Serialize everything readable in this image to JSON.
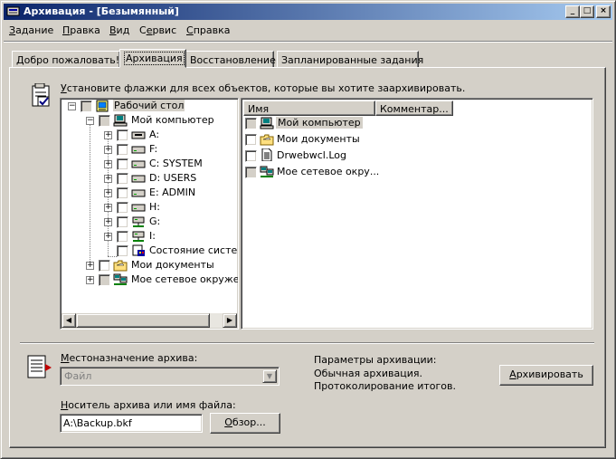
{
  "window": {
    "title": "Архивация - [Безымянный]",
    "controls": {
      "minimize": "_",
      "maximize": "□",
      "close": "×"
    }
  },
  "menu": [
    {
      "label": "Задание",
      "accel": "З",
      "rest": "адание"
    },
    {
      "label": "Правка",
      "accel": "П",
      "rest": "равка"
    },
    {
      "label": "Вид",
      "accel": "В",
      "rest": "ид"
    },
    {
      "label": "Сервис",
      "accel": "е",
      "pre": "С",
      "rest": "рвис"
    },
    {
      "label": "Справка",
      "accel": "С",
      "rest": "правка"
    }
  ],
  "tabs": [
    {
      "label": "Добро пожаловать!",
      "active": false
    },
    {
      "label": "Архивация",
      "active": true
    },
    {
      "label": "Восстановление",
      "active": false
    },
    {
      "label": "Запланированные задания",
      "active": false
    }
  ],
  "instruction": {
    "accel": "У",
    "rest": "становите флажки для всех объектов, которые вы хотите заархивировать."
  },
  "tree": [
    {
      "label": "Рабочий стол",
      "icon": "desktop-icon",
      "expander": "−",
      "check": "gray",
      "selected": true
    },
    {
      "label": "Мой компьютер",
      "icon": "computer-icon",
      "expander": "−",
      "check": "gray"
    },
    {
      "label": "A:",
      "icon": "floppy-drive-icon",
      "expander": "+",
      "check": "white"
    },
    {
      "label": "F:",
      "icon": "drive-icon",
      "expander": "+",
      "check": "white"
    },
    {
      "label": "C: SYSTEM",
      "icon": "drive-icon",
      "expander": "+",
      "check": "white"
    },
    {
      "label": "D: USERS",
      "icon": "drive-icon",
      "expander": "+",
      "check": "white"
    },
    {
      "label": "E: ADMIN",
      "icon": "drive-icon",
      "expander": "+",
      "check": "white"
    },
    {
      "label": "H:",
      "icon": "drive-icon",
      "expander": "+",
      "check": "white"
    },
    {
      "label": "G:",
      "icon": "network-drive-icon",
      "expander": "+",
      "check": "white"
    },
    {
      "label": "I:",
      "icon": "network-drive-icon",
      "expander": "+",
      "check": "white"
    },
    {
      "label": "Состояние систе",
      "icon": "system-state-icon",
      "expander": "",
      "check": "white"
    },
    {
      "label": "Мои документы",
      "icon": "documents-folder-icon",
      "expander": "+",
      "check": "white"
    },
    {
      "label": "Мое сетевое окруже",
      "icon": "network-places-icon",
      "expander": "+",
      "check": "gray"
    }
  ],
  "list": {
    "columns": [
      "Имя",
      "Комментар..."
    ],
    "rows": [
      {
        "label": "Мой компьютер",
        "icon": "computer-icon",
        "check": "gray",
        "selected": true
      },
      {
        "label": "Мои документы",
        "icon": "documents-folder-icon",
        "check": "white"
      },
      {
        "label": "Drwebwcl.Log",
        "icon": "text-file-icon",
        "check": "white"
      },
      {
        "label": "Мое сетевое окру...",
        "icon": "network-places-icon",
        "check": "gray"
      }
    ]
  },
  "destination": {
    "label_accel": "М",
    "label_rest": "естоназначение архива:",
    "value": "Файл"
  },
  "media": {
    "label_accel": "Н",
    "label_rest": "оситель архива или имя файла:",
    "value": "A:\\Backup.bkf",
    "browse_accel": "О",
    "browse_rest": "бзор..."
  },
  "params": {
    "title": "Параметры архивации:",
    "line1": "Обычная архивация.",
    "line2": "Протоколирование итогов."
  },
  "archive_button": {
    "accel": "А",
    "rest": "рхивировать"
  }
}
